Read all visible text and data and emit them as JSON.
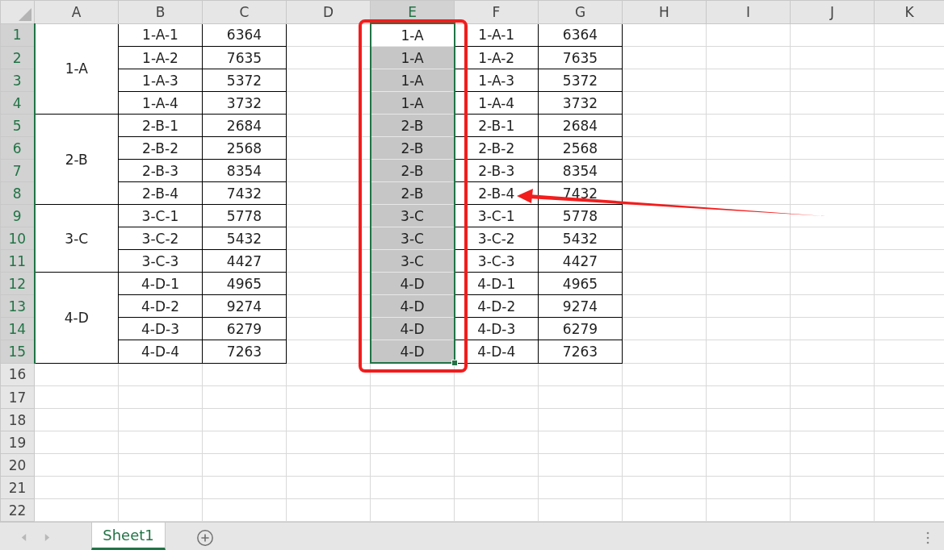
{
  "columns": [
    {
      "label": "A",
      "selected": false
    },
    {
      "label": "B",
      "selected": false
    },
    {
      "label": "C",
      "selected": false
    },
    {
      "label": "D",
      "selected": false
    },
    {
      "label": "E",
      "selected": true
    },
    {
      "label": "F",
      "selected": false
    },
    {
      "label": "G",
      "selected": false
    },
    {
      "label": "H",
      "selected": false
    },
    {
      "label": "I",
      "selected": false
    },
    {
      "label": "J",
      "selected": false
    },
    {
      "label": "K",
      "selected": false
    }
  ],
  "row_headers": [
    {
      "label": "1",
      "selected": true
    },
    {
      "label": "2",
      "selected": true
    },
    {
      "label": "3",
      "selected": true
    },
    {
      "label": "4",
      "selected": true
    },
    {
      "label": "5",
      "selected": true
    },
    {
      "label": "6",
      "selected": true
    },
    {
      "label": "7",
      "selected": true
    },
    {
      "label": "8",
      "selected": true
    },
    {
      "label": "9",
      "selected": true
    },
    {
      "label": "10",
      "selected": true
    },
    {
      "label": "11",
      "selected": true
    },
    {
      "label": "12",
      "selected": true
    },
    {
      "label": "13",
      "selected": true
    },
    {
      "label": "14",
      "selected": true
    },
    {
      "label": "15",
      "selected": true
    },
    {
      "label": "16",
      "selected": false
    },
    {
      "label": "17",
      "selected": false
    },
    {
      "label": "18",
      "selected": false
    },
    {
      "label": "19",
      "selected": false
    },
    {
      "label": "20",
      "selected": false
    },
    {
      "label": "21",
      "selected": false
    },
    {
      "label": "22",
      "selected": false
    }
  ],
  "source_groups": [
    {
      "label": "1-A",
      "items": [
        {
          "code": "1-A-1",
          "value": "6364"
        },
        {
          "code": "1-A-2",
          "value": "7635"
        },
        {
          "code": "1-A-3",
          "value": "5372"
        },
        {
          "code": "1-A-4",
          "value": "3732"
        }
      ]
    },
    {
      "label": "2-B",
      "items": [
        {
          "code": "2-B-1",
          "value": "2684"
        },
        {
          "code": "2-B-2",
          "value": "2568"
        },
        {
          "code": "2-B-3",
          "value": "8354"
        },
        {
          "code": "2-B-4",
          "value": "7432"
        }
      ]
    },
    {
      "label": "3-C",
      "items": [
        {
          "code": "3-C-1",
          "value": "5778"
        },
        {
          "code": "3-C-2",
          "value": "5432"
        },
        {
          "code": "3-C-3",
          "value": "4427"
        }
      ]
    },
    {
      "label": "4-D",
      "items": [
        {
          "code": "4-D-1",
          "value": "4965"
        },
        {
          "code": "4-D-2",
          "value": "9274"
        },
        {
          "code": "4-D-3",
          "value": "6279"
        },
        {
          "code": "4-D-4",
          "value": "7263"
        }
      ]
    }
  ],
  "filled_column": [
    {
      "text": "1-A",
      "highlighted": false
    },
    {
      "text": "1-A",
      "highlighted": true
    },
    {
      "text": "1-A",
      "highlighted": true
    },
    {
      "text": "1-A",
      "highlighted": true
    },
    {
      "text": "2-B",
      "highlighted": true
    },
    {
      "text": "2-B",
      "highlighted": true
    },
    {
      "text": "2-B",
      "highlighted": true
    },
    {
      "text": "2-B",
      "highlighted": true
    },
    {
      "text": "3-C",
      "highlighted": true
    },
    {
      "text": "3-C",
      "highlighted": true
    },
    {
      "text": "3-C",
      "highlighted": true
    },
    {
      "text": "4-D",
      "highlighted": true
    },
    {
      "text": "4-D",
      "highlighted": true
    },
    {
      "text": "4-D",
      "highlighted": true
    },
    {
      "text": "4-D",
      "highlighted": true
    }
  ],
  "copy_table": [
    {
      "code": "1-A-1",
      "value": "6364"
    },
    {
      "code": "1-A-2",
      "value": "7635"
    },
    {
      "code": "1-A-3",
      "value": "5372"
    },
    {
      "code": "1-A-4",
      "value": "3732"
    },
    {
      "code": "2-B-1",
      "value": "2684"
    },
    {
      "code": "2-B-2",
      "value": "2568"
    },
    {
      "code": "2-B-3",
      "value": "8354"
    },
    {
      "code": "2-B-4",
      "value": "7432"
    },
    {
      "code": "3-C-1",
      "value": "5778"
    },
    {
      "code": "3-C-2",
      "value": "5432"
    },
    {
      "code": "3-C-3",
      "value": "4427"
    },
    {
      "code": "4-D-1",
      "value": "4965"
    },
    {
      "code": "4-D-2",
      "value": "9274"
    },
    {
      "code": "4-D-3",
      "value": "6279"
    },
    {
      "code": "4-D-4",
      "value": "7263"
    }
  ],
  "annotations": {
    "highlight_box": true,
    "arrow": true
  },
  "sheet_tabs": [
    {
      "label": "Sheet1",
      "selected": true
    }
  ]
}
